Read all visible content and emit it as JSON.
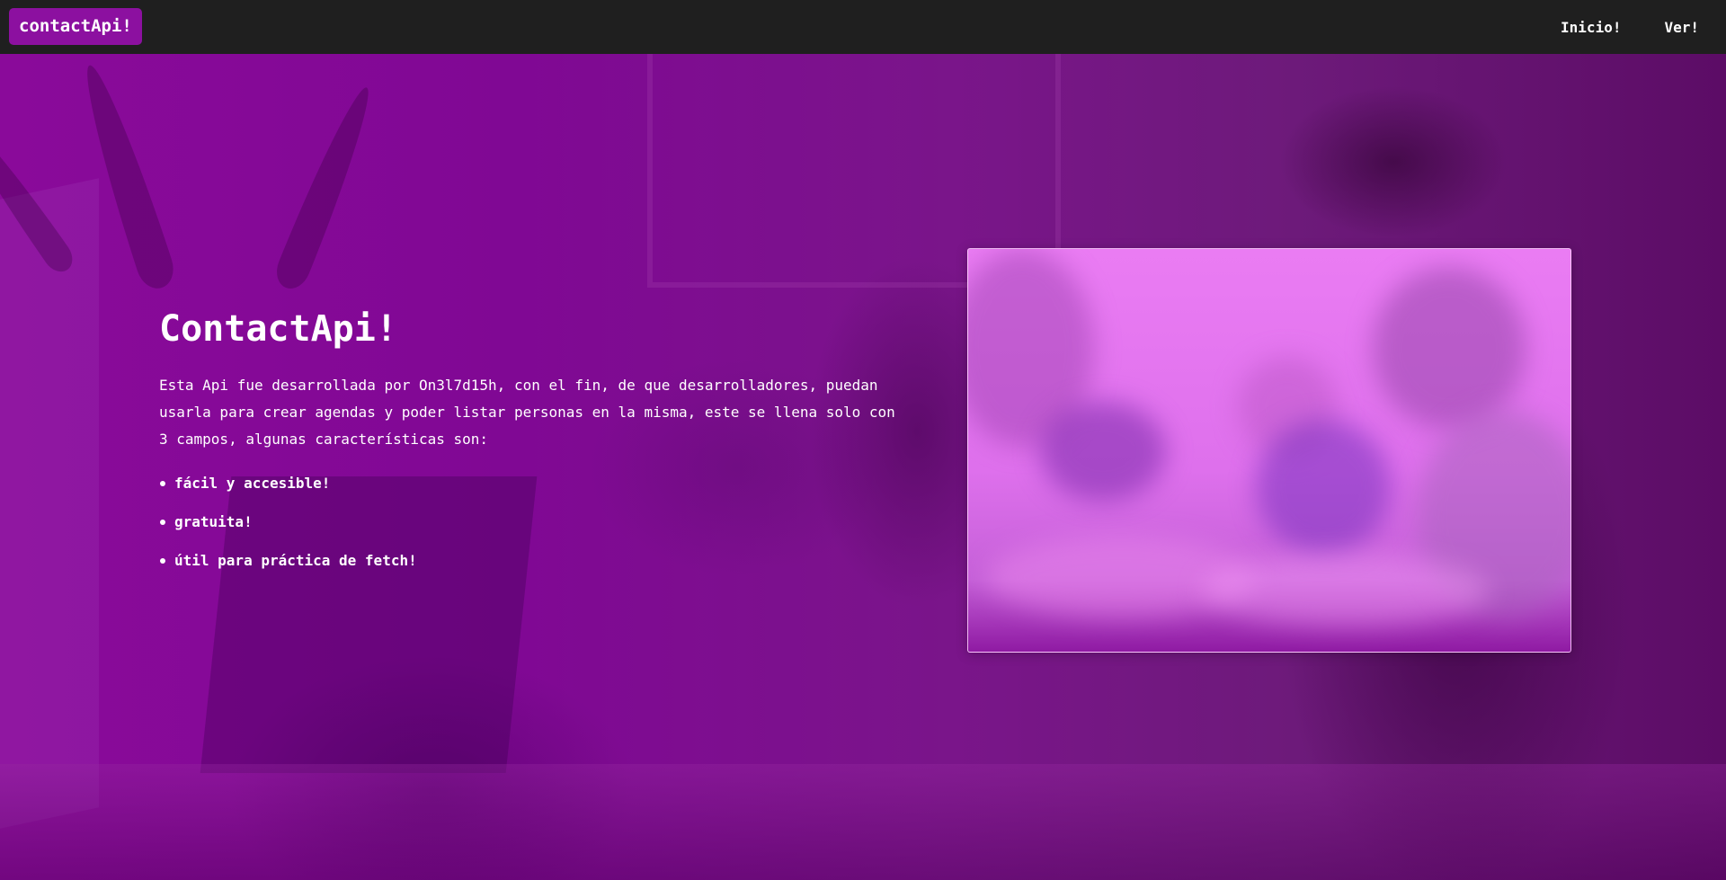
{
  "navbar": {
    "brand": "contactApi!",
    "links": [
      {
        "label": "Inicio!"
      },
      {
        "label": "Ver!"
      }
    ]
  },
  "hero": {
    "title": "ContactApi!",
    "description": "Esta Api fue desarrollada por On3l7d15h, con el fin, de que desarrolladores, puedan usarla para crear agendas y poder listar personas en la misma, este se llena solo con 3 campos, algunas características son:",
    "features": [
      "fácil y accesible!",
      "gratuita!",
      "útil para práctica de fetch!"
    ]
  },
  "colors": {
    "navbar_bg": "#1f1f1f",
    "brand_bg": "#8c10a0",
    "hero_tint": "#800894",
    "text": "#ffffff"
  }
}
